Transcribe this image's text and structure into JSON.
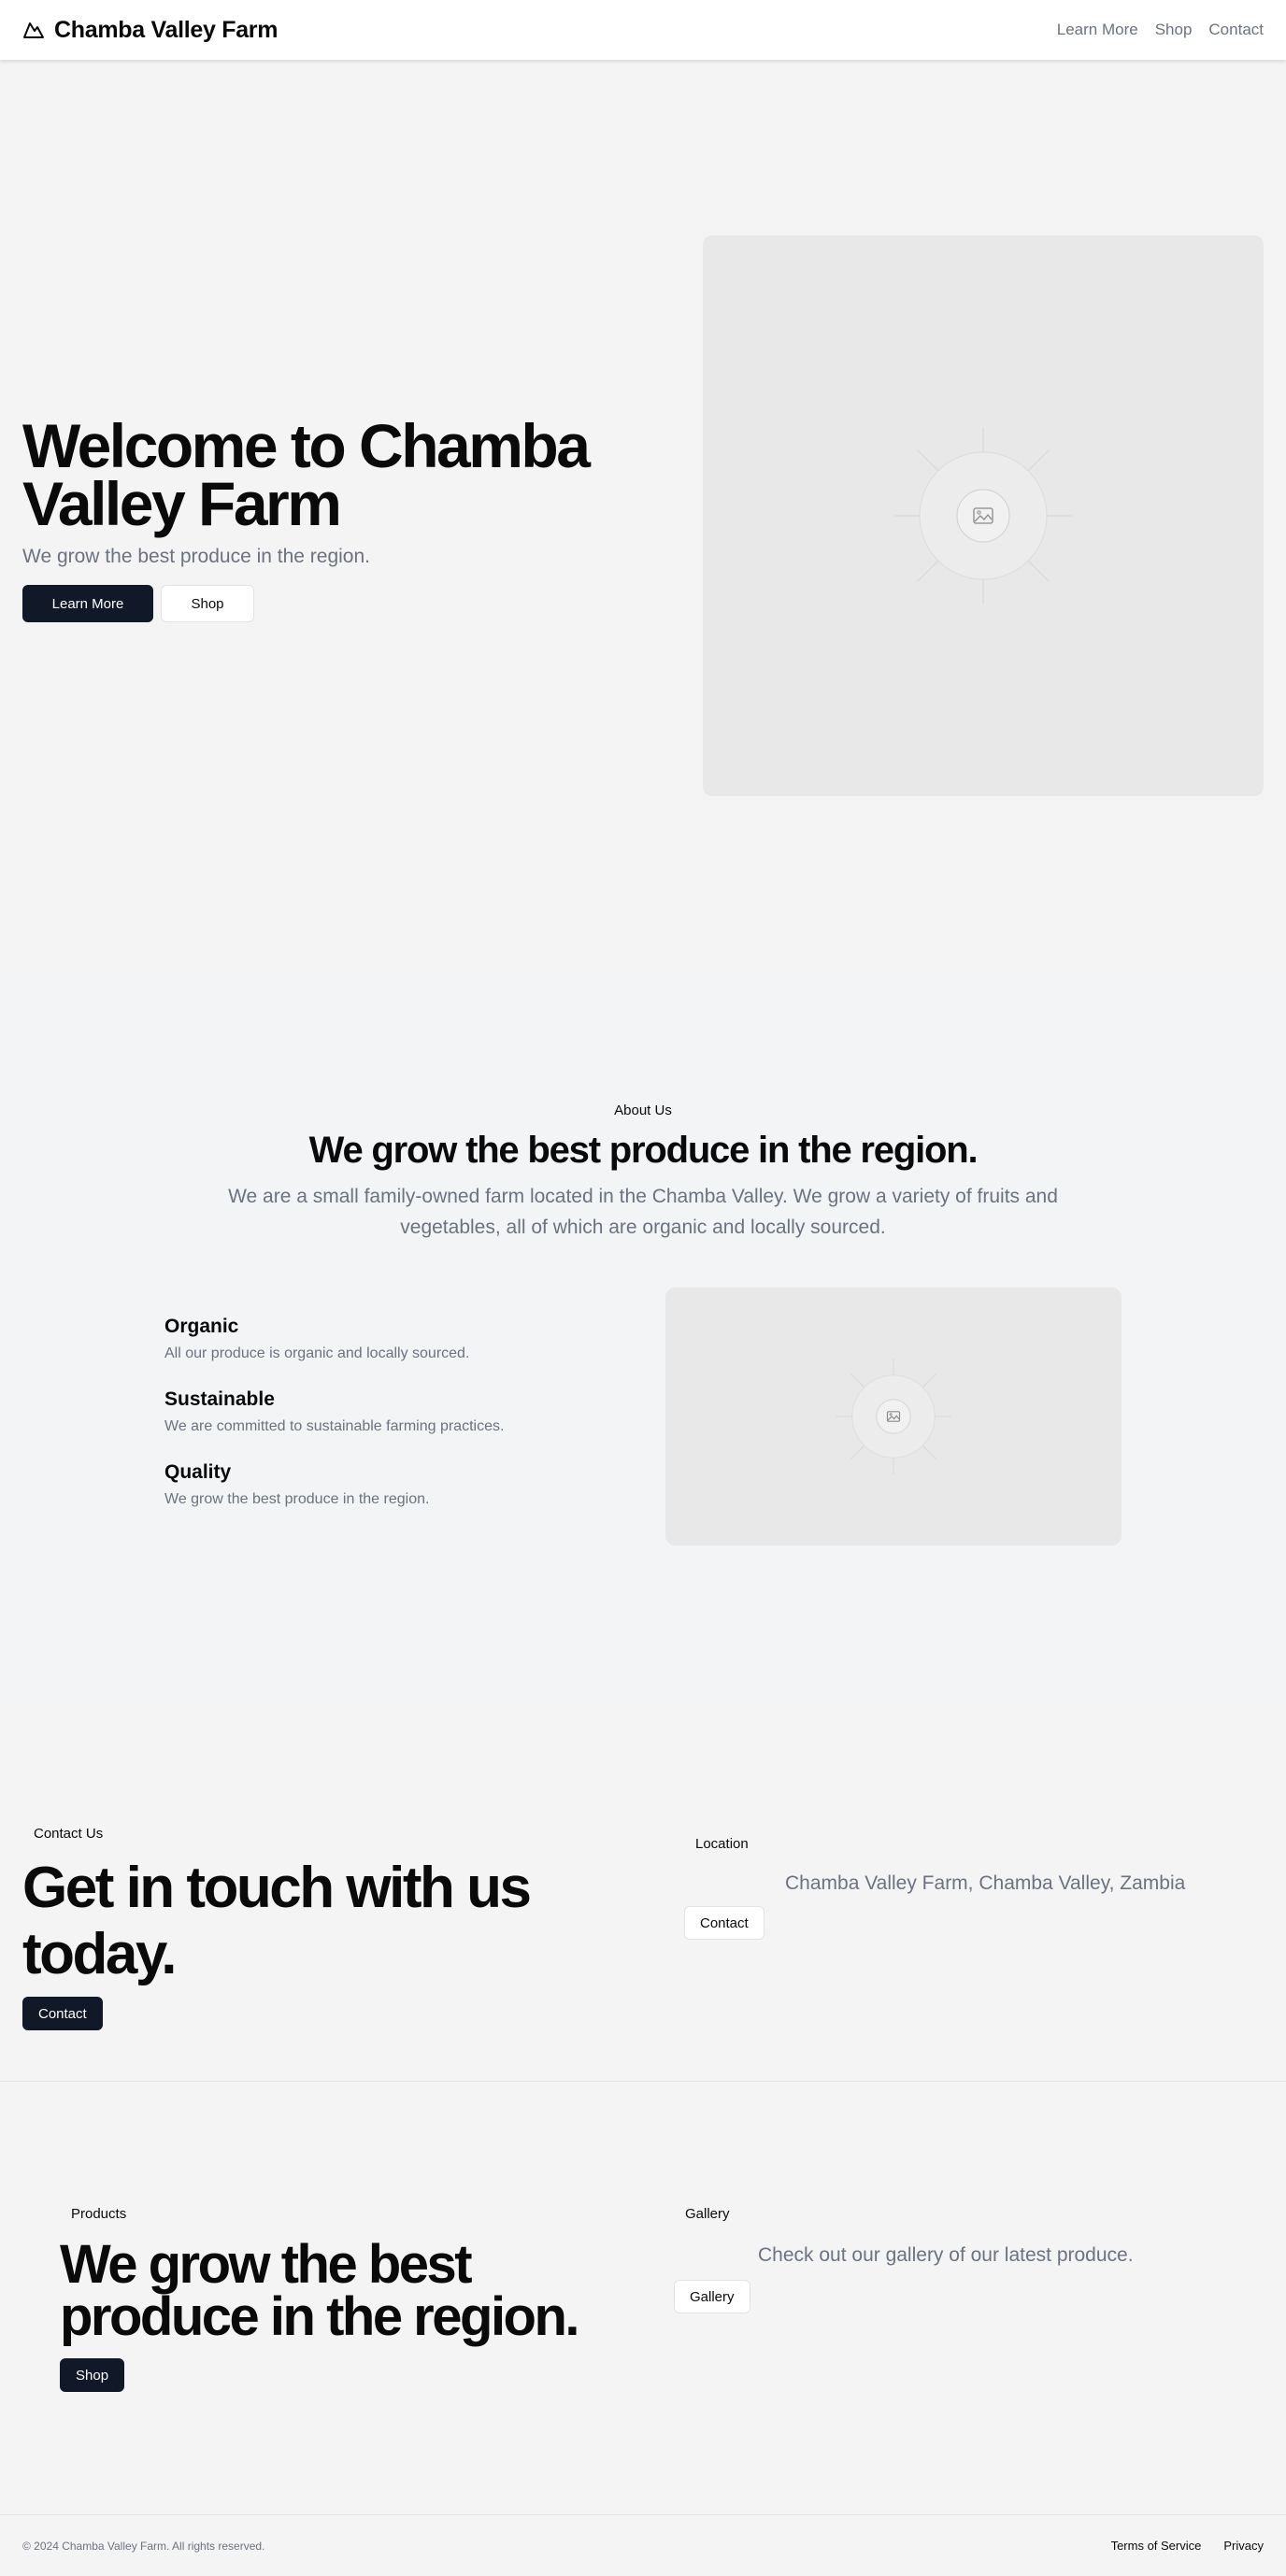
{
  "header": {
    "brand": "Chamba Valley Farm",
    "brand_icon": "mountain-icon",
    "nav": [
      "Learn More",
      "Shop",
      "Contact"
    ]
  },
  "hero": {
    "title": "Welcome to Chamba Valley Farm",
    "subtitle": "We grow the best produce in the region.",
    "primary_button": "Learn More",
    "secondary_button": "Shop",
    "image_icon": "image-placeholder-icon"
  },
  "about": {
    "eyebrow": "About Us",
    "title": "We grow the best produce in the region.",
    "text": "We are a small family-owned farm located in the Chamba Valley. We grow a variety of fruits and vegetables, all of which are organic and locally sourced.",
    "features": [
      {
        "title": "Organic",
        "desc": "All our produce is organic and locally sourced."
      },
      {
        "title": "Sustainable",
        "desc": "We are committed to sustainable farming practices."
      },
      {
        "title": "Quality",
        "desc": "We grow the best produce in the region."
      }
    ]
  },
  "contact": {
    "eyebrow": "Contact Us",
    "title": "Get in touch with us today.",
    "button": "Contact",
    "location_eyebrow": "Location",
    "location_text": "Chamba Valley Farm, Chamba Valley, Zambia",
    "location_button": "Contact"
  },
  "products": {
    "eyebrow": "Products",
    "title": "We grow the best produce in the region.",
    "button": "Shop",
    "gallery_eyebrow": "Gallery",
    "gallery_text": "Check out our gallery of our latest produce.",
    "gallery_button": "Gallery"
  },
  "footer": {
    "copyright": "© 2024 Chamba Valley Farm. All rights reserved.",
    "links": [
      "Terms of Service",
      "Privacy"
    ]
  },
  "colors": {
    "accent": "#111827",
    "muted_text": "#6b7280",
    "page_bg": "#f4f4f4",
    "placeholder_bg": "#e8e8e8"
  }
}
